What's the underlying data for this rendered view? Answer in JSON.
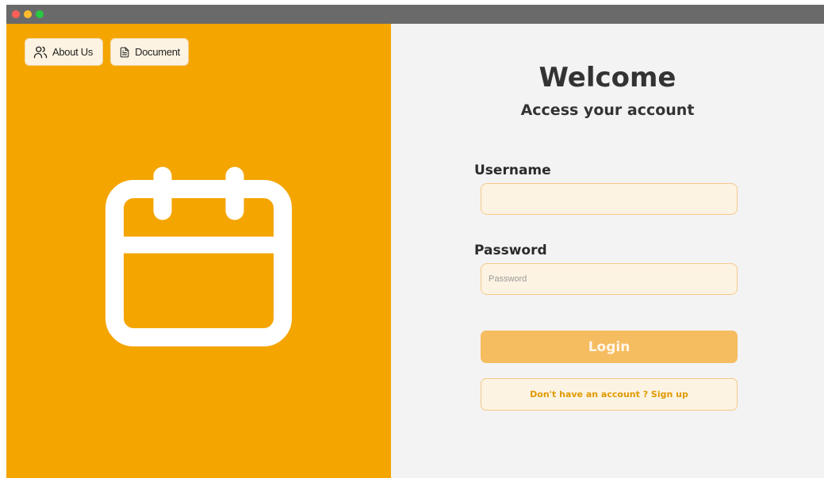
{
  "header": {
    "about_label": "About Us",
    "document_label": "Document"
  },
  "login": {
    "title": "Welcome",
    "subtitle": "Access your account",
    "username_label": "Username",
    "username_value": "",
    "password_label": "Password",
    "password_placeholder": "Password",
    "login_label": "Login",
    "signup_label": "Don't have an account ? Sign up"
  },
  "colors": {
    "left_panel": "#f4a500",
    "right_panel": "#f3f3f3",
    "login_button": "#f5bc60",
    "input_background": "#fdf3e2",
    "signup_text": "#e09a00"
  },
  "icons": {
    "about": "users-icon",
    "document": "document-icon",
    "hero": "calendar-icon"
  }
}
